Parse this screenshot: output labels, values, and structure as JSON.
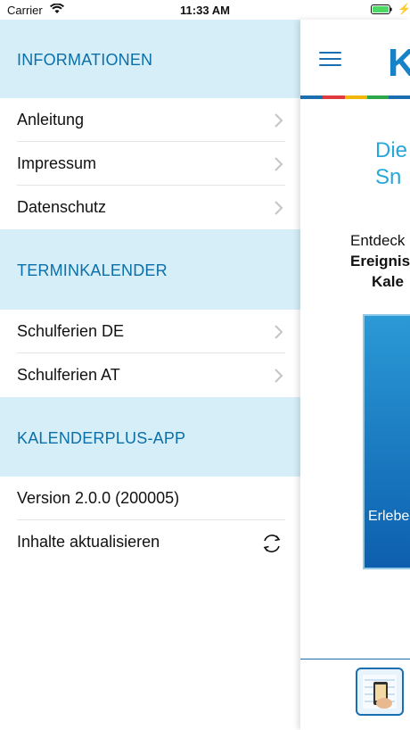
{
  "status_bar": {
    "carrier": "Carrier",
    "time": "11:33 AM"
  },
  "menu": {
    "sections": [
      {
        "title": "INFORMATIONEN",
        "items": [
          "Anleitung",
          "Impressum",
          "Datenschutz"
        ]
      },
      {
        "title": "TERMINKALENDER",
        "items": [
          "Schulferien DE",
          "Schulferien AT"
        ]
      },
      {
        "title": "KALENDERPLUS-APP",
        "items": [
          "Version 2.0.0 (200005)",
          "Inhalte aktualisieren"
        ]
      }
    ]
  },
  "content": {
    "logo_letter": "K",
    "teaser_title": "Die Sn",
    "teaser_sub_1": "Entdeck",
    "teaser_sub_2": "Ereignis",
    "teaser_sub_3": "Kale",
    "promo_text": "Erlebe"
  },
  "colors": {
    "section_bg": "#d6eef8",
    "section_text": "#0c6fa8",
    "accent_blue": "#1683c8",
    "stripe": [
      "#1a6fb0",
      "#e03a3e",
      "#f2b705",
      "#2aa84a",
      "#1a6fb0"
    ]
  },
  "icons": {
    "wifi": "wifi-icon",
    "battery": "battery-icon",
    "chevron": "chevron-right-icon",
    "sync": "refresh-icon",
    "menu": "hamburger-icon"
  }
}
